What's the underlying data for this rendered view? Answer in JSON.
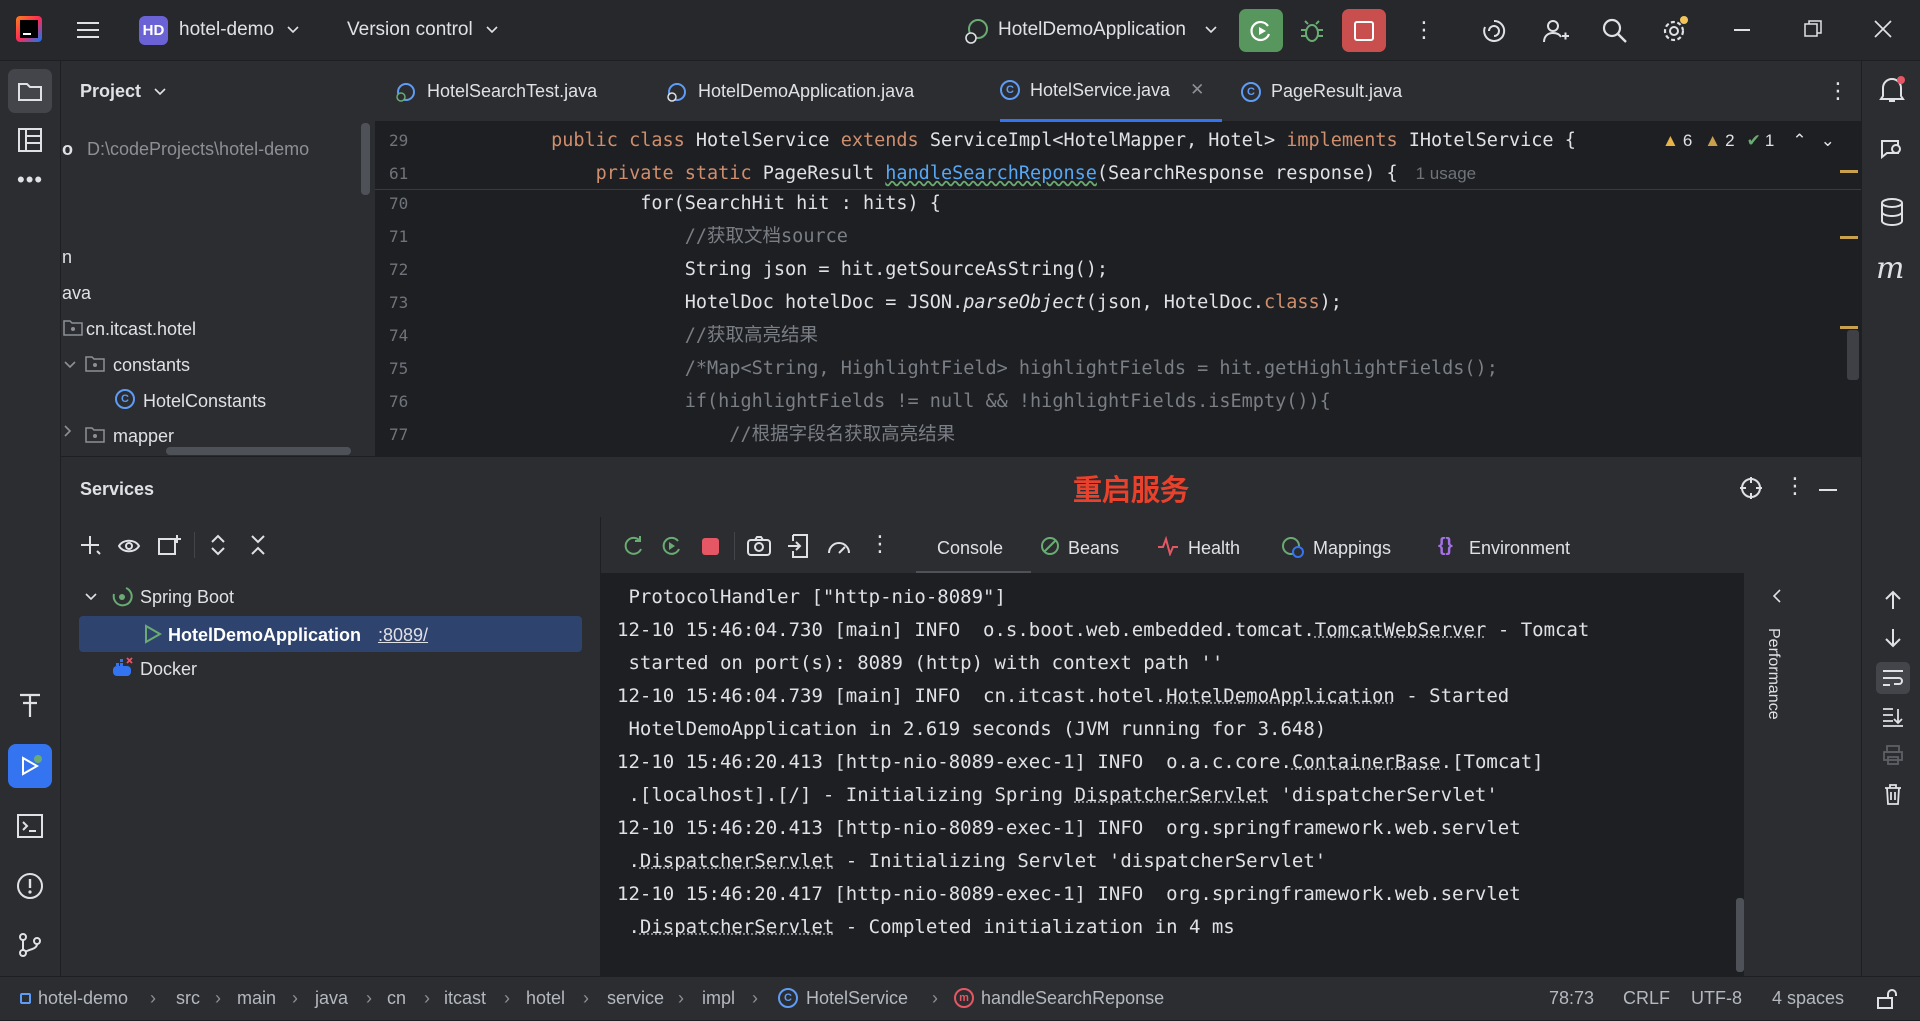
{
  "titlebar": {
    "project_badge": "HD",
    "project_name": "hotel-demo",
    "vcs_label": "Version control",
    "run_config": "HotelDemoApplication"
  },
  "project_panel": {
    "title": "Project",
    "root_name": "o",
    "root_path": "D:\\codeProjects\\hotel-demo",
    "items": [
      "n",
      "ava",
      "cn.itcast.hotel",
      "constants",
      "HotelConstants",
      "mapper"
    ]
  },
  "editor": {
    "tabs": [
      {
        "label": "HotelSearchTest.java"
      },
      {
        "label": "HotelDemoApplication.java"
      },
      {
        "label": "HotelService.java",
        "active": true
      },
      {
        "label": "PageResult.java"
      }
    ],
    "inspections": {
      "warnings": "6",
      "weak_warnings": "2",
      "ok": "1"
    },
    "usage_hint": "1 usage",
    "lines": [
      {
        "num": "29",
        "parts": [
          [
            "        ",
            ""
          ],
          [
            "public class ",
            "kw"
          ],
          [
            "HotelService ",
            ""
          ],
          [
            "extends ",
            "kw"
          ],
          [
            "ServiceImpl<HotelMapper, Hotel> ",
            ""
          ],
          [
            "implements ",
            "kw"
          ],
          [
            "IHotelService {",
            ""
          ]
        ]
      },
      {
        "num": "61",
        "parts": [
          [
            "            ",
            ""
          ],
          [
            "private static ",
            "kw"
          ],
          [
            "PageResult ",
            ""
          ],
          [
            "handleSearchReponse",
            "fn"
          ],
          [
            "(SearchResponse response) {",
            ""
          ]
        ]
      },
      {
        "num": "70",
        "parts": [
          [
            "                for(SearchHit hit : hits) {",
            ""
          ]
        ]
      },
      {
        "num": "71",
        "parts": [
          [
            "                    ",
            ""
          ],
          [
            "//获取文档source",
            "cm"
          ]
        ]
      },
      {
        "num": "72",
        "parts": [
          [
            "                    String json = hit.getSourceAsString();",
            ""
          ]
        ]
      },
      {
        "num": "73",
        "parts": [
          [
            "                    HotelDoc hotelDoc = JSON.",
            ""
          ],
          [
            "parseObject",
            "it"
          ],
          [
            "(json, HotelDoc.",
            ""
          ],
          [
            "class",
            "kw"
          ],
          [
            ");",
            ""
          ]
        ]
      },
      {
        "num": "74",
        "parts": [
          [
            "                    ",
            ""
          ],
          [
            "//获取高亮结果",
            "cm"
          ]
        ]
      },
      {
        "num": "75",
        "parts": [
          [
            "                    ",
            ""
          ],
          [
            "/*Map<String, HighlightField> highlightFields = hit.getHighlightFields();",
            "cm"
          ]
        ]
      },
      {
        "num": "76",
        "parts": [
          [
            "                    ",
            ""
          ],
          [
            "if(highlightFields != null && !highlightFields.isEmpty()){",
            "cm"
          ]
        ]
      },
      {
        "num": "77",
        "parts": [
          [
            "                        ",
            ""
          ],
          [
            "//根据字段名获取高亮结果",
            "cm"
          ]
        ]
      }
    ]
  },
  "services": {
    "title": "Services",
    "annotation": "重启服务",
    "tree": {
      "group": "Spring Boot",
      "app": "HotelDemoApplication",
      "port": ":8089/",
      "docker": "Docker"
    },
    "tabs": [
      "Console",
      "Beans",
      "Health",
      "Mappings",
      "Environment"
    ],
    "side_label": "Performance",
    "console_lines": [
      " ProtocolHandler [\"http-nio-8089\"]",
      "12-10 15:46:04.730 [main] INFO  o.s.boot.web.embedded.tomcat.TomcatWebServer - Tomcat",
      " started on port(s): 8089 (http) with context path ''",
      "12-10 15:46:04.739 [main] INFO  cn.itcast.hotel.HotelDemoApplication - Started",
      " HotelDemoApplication in 2.619 seconds (JVM running for 3.648)",
      "12-10 15:46:20.413 [http-nio-8089-exec-1] INFO  o.a.c.core.ContainerBase.[Tomcat]",
      " .[localhost].[/] - Initializing Spring DispatcherServlet 'dispatcherServlet'",
      "12-10 15:46:20.413 [http-nio-8089-exec-1] INFO  org.springframework.web.servlet",
      " .DispatcherServlet - Initializing Servlet 'dispatcherServlet'",
      "12-10 15:46:20.417 [http-nio-8089-exec-1] INFO  org.springframework.web.servlet",
      " .DispatcherServlet - Completed initialization in 4 ms"
    ]
  },
  "statusbar": {
    "breadcrumb": [
      "hotel-demo",
      "src",
      "main",
      "java",
      "cn",
      "itcast",
      "hotel",
      "service",
      "impl",
      "HotelService",
      "handleSearchReponse"
    ],
    "position": "78:73",
    "line_sep": "CRLF",
    "encoding": "UTF-8",
    "indent": "4 spaces"
  },
  "colors": {
    "accent": "#3574f0",
    "annotation": "#e8412c",
    "run_green": "#57965c",
    "stop_red": "#c94f4f"
  }
}
